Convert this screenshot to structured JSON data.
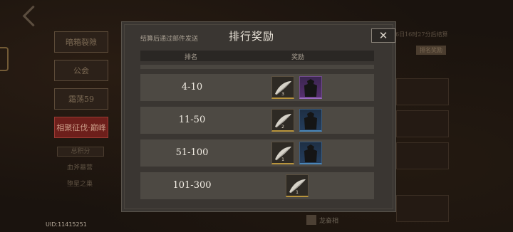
{
  "background": {
    "uid": "UID:11415251",
    "sidebar": {
      "items": [
        "暗箱裂隙",
        "公会",
        "霜荡59",
        "相聚征伐·巅峰"
      ],
      "labels": [
        "总积分",
        "血斧墓营",
        "堕星之巢"
      ]
    },
    "right": {
      "deadline": "6日16时27分后结算",
      "tag": "排名奖励"
    },
    "bottom_tag": "龙奋相"
  },
  "modal": {
    "subtitle": "结算后通过邮件发送",
    "title": "排行奖励",
    "close_icon": "close-icon",
    "columns": {
      "rank": "排名",
      "reward": "奖励"
    },
    "rows": [
      {
        "rank": "4-10",
        "rewards": [
          {
            "icon": "feather-icon",
            "count": "3",
            "rarity": "gold"
          },
          {
            "icon": "armor-icon",
            "count": "",
            "rarity": "purple"
          }
        ]
      },
      {
        "rank": "11-50",
        "rewards": [
          {
            "icon": "feather-icon",
            "count": "2",
            "rarity": "gold"
          },
          {
            "icon": "armor-icon",
            "count": "",
            "rarity": "blue"
          }
        ]
      },
      {
        "rank": "51-100",
        "rewards": [
          {
            "icon": "feather-icon",
            "count": "1",
            "rarity": "gold"
          },
          {
            "icon": "armor-icon",
            "count": "",
            "rarity": "blue"
          }
        ]
      },
      {
        "rank": "101-300",
        "rewards": [
          {
            "icon": "feather-icon",
            "count": "1",
            "rarity": "gold"
          }
        ]
      }
    ]
  },
  "colors": {
    "modal_bg": "#3a3632",
    "row_bg": "#4d4943",
    "gold_border": "#b8943c",
    "purple_bg": "#552f6e",
    "blue_bg": "#243d5c",
    "active_red": "#6d1f1b"
  }
}
